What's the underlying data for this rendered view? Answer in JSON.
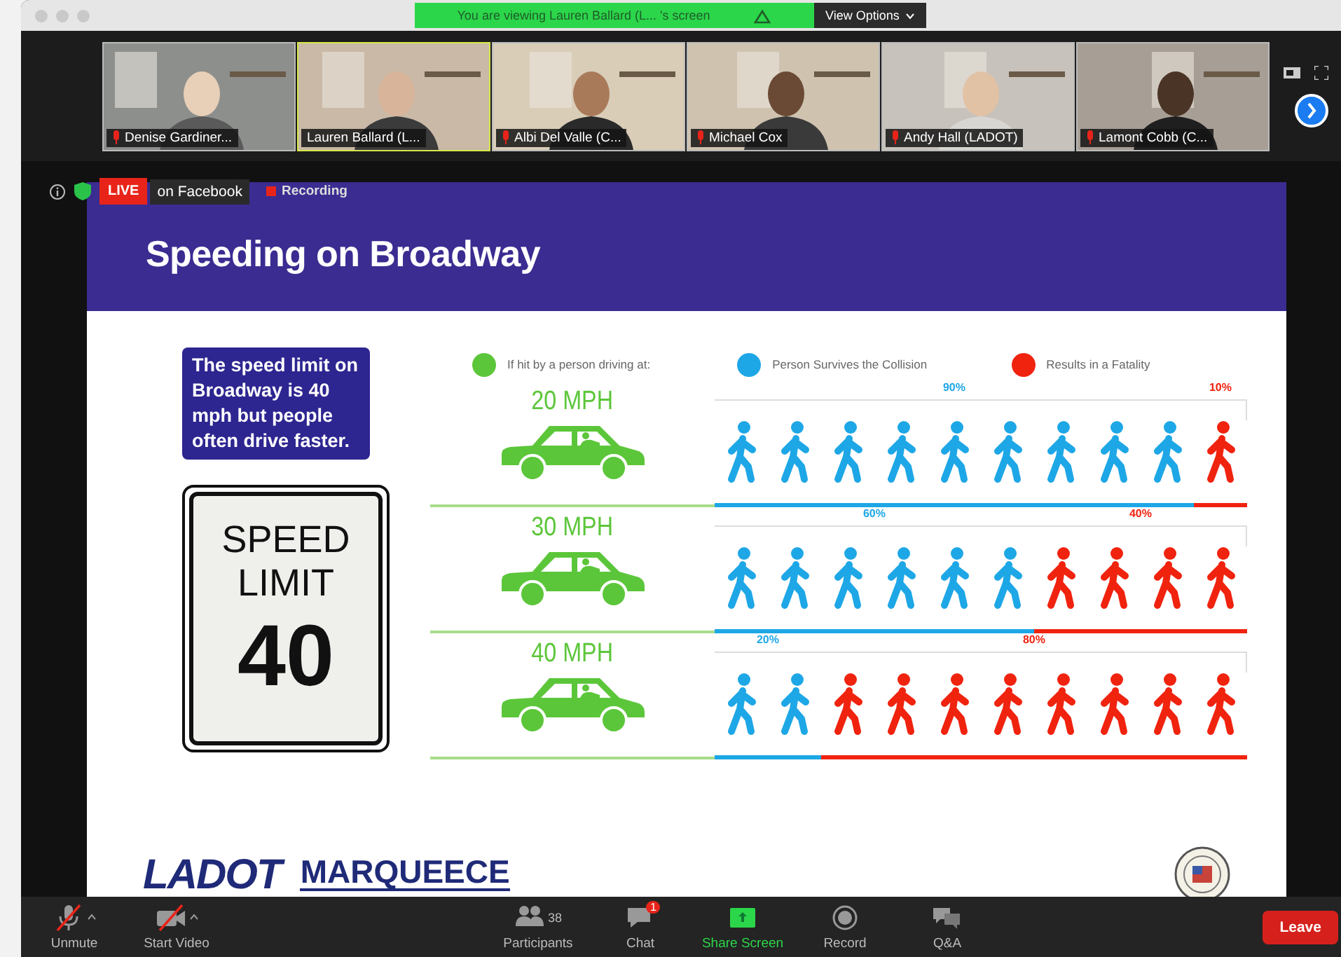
{
  "window": {
    "banner": "You are viewing Lauren Ballard (L... 's screen",
    "view_options": "View Options"
  },
  "participants": [
    {
      "name": "Denise Gardiner...",
      "muted": true,
      "selected": false
    },
    {
      "name": "Lauren Ballard (L...",
      "muted": false,
      "selected": true
    },
    {
      "name": "Albi Del Valle (C...",
      "muted": true,
      "selected": false
    },
    {
      "name": "Michael Cox",
      "muted": true,
      "selected": false
    },
    {
      "name": "Andy Hall (LADOT)",
      "muted": true,
      "selected": false
    },
    {
      "name": "Lamont Cobb (C...",
      "muted": true,
      "selected": false
    }
  ],
  "meeting_status": {
    "live_badge": "LIVE",
    "live_platform": "on Facebook",
    "recording": "Recording"
  },
  "slide": {
    "title": "Speeding on Broadway",
    "callout": "The speed limit on Broadway is 40 mph but people often drive faster.",
    "sign": {
      "line_1": "SPEED",
      "line_2": "LIMIT",
      "number": "40"
    },
    "legend": [
      {
        "label": "If hit by a person driving at:",
        "color": "#5cc63a"
      },
      {
        "label": "Person Survives the Collision",
        "color": "#1ea7e6"
      },
      {
        "label": "Results in a Fatality",
        "color": "#f0230f"
      }
    ],
    "rows": [
      {
        "speed": "20 MPH",
        "survive_label": "90%",
        "fatal_label": "10%",
        "figures": [
          {
            "kind": "survive"
          },
          {
            "kind": "survive"
          },
          {
            "kind": "survive"
          },
          {
            "kind": "survive"
          },
          {
            "kind": "survive"
          },
          {
            "kind": "survive"
          },
          {
            "kind": "survive"
          },
          {
            "kind": "survive"
          },
          {
            "kind": "survive"
          },
          {
            "kind": "fatal"
          }
        ]
      },
      {
        "speed": "30 MPH",
        "survive_label": "60%",
        "fatal_label": "40%",
        "figures": [
          {
            "kind": "survive"
          },
          {
            "kind": "survive"
          },
          {
            "kind": "survive"
          },
          {
            "kind": "survive"
          },
          {
            "kind": "survive"
          },
          {
            "kind": "survive"
          },
          {
            "kind": "fatal"
          },
          {
            "kind": "fatal"
          },
          {
            "kind": "fatal"
          },
          {
            "kind": "fatal"
          }
        ]
      },
      {
        "speed": "40 MPH",
        "survive_label": "20%",
        "fatal_label": "80%",
        "figures": [
          {
            "kind": "survive"
          },
          {
            "kind": "survive"
          },
          {
            "kind": "fatal"
          },
          {
            "kind": "fatal"
          },
          {
            "kind": "fatal"
          },
          {
            "kind": "fatal"
          },
          {
            "kind": "fatal"
          },
          {
            "kind": "fatal"
          },
          {
            "kind": "fatal"
          },
          {
            "kind": "fatal"
          }
        ]
      }
    ],
    "logos": {
      "ladot": "LADOT",
      "marqueece": "MARQUEECE"
    }
  },
  "toolbar": {
    "items": [
      {
        "kind": "mic",
        "label": "Unmute",
        "slashed": true
      },
      {
        "kind": "video",
        "label": "Start Video",
        "slashed": true
      },
      {
        "kind": "participants",
        "label": "Participants",
        "count": "38"
      },
      {
        "kind": "chat",
        "label": "Chat",
        "badge": "1"
      },
      {
        "kind": "share",
        "label": "Share Screen"
      },
      {
        "kind": "record",
        "label": "Record"
      },
      {
        "kind": "qa",
        "label": "Q&A"
      }
    ],
    "leave": "Leave"
  }
}
